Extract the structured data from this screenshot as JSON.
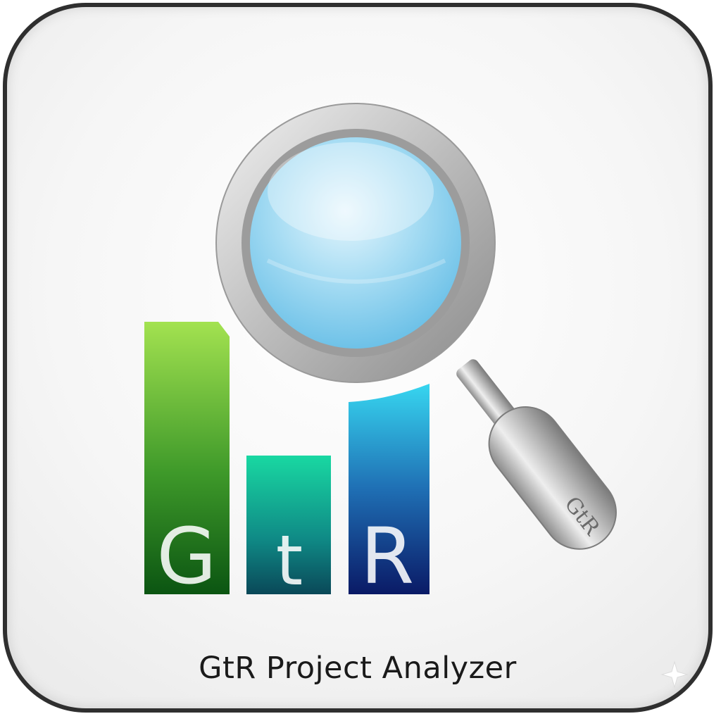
{
  "app": {
    "name": "GtR Project Analyzer"
  },
  "logo": {
    "bar_letters": [
      "G",
      "t",
      "R"
    ],
    "handle_engraving": "GtR"
  },
  "colors": {
    "border": "#2f2f2f",
    "background": "#f4f4f4",
    "bar_green_top": "#a0e04c",
    "bar_green_bottom": "#0d5a14",
    "bar_teal_top": "#18d6a0",
    "bar_teal_bottom": "#0a4a5a",
    "bar_blue_top": "#35d4ee",
    "bar_blue_bottom": "#0a1c66",
    "lens": "#7ac9ea",
    "metal": "#b9b9b9",
    "text": "#1a1a1a"
  },
  "icons": [
    "magnifying-glass-icon",
    "bar-chart-icon",
    "sparkle-icon"
  ]
}
